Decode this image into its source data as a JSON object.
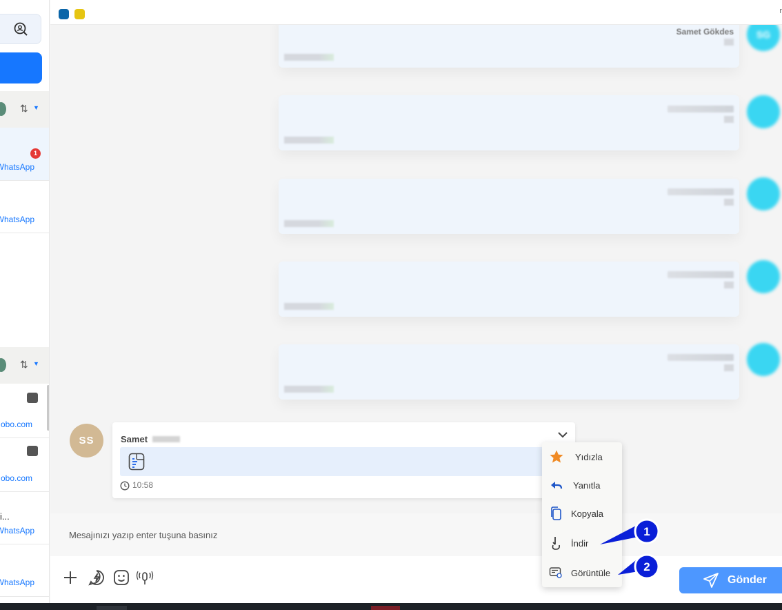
{
  "sidebar": {
    "badge_count": "1",
    "items": [
      {
        "label": "WhatsApp"
      },
      {
        "label": "WhatsApp"
      },
      {
        "label": "obo.com"
      },
      {
        "label": "obo.com"
      },
      {
        "label_top": "i...",
        "label": "WhatsApp"
      },
      {
        "label": "WhatsApp"
      }
    ]
  },
  "topbar": {
    "dot_colors": [
      "#0a65a8",
      "#e6c512"
    ],
    "corner_glyph": "r"
  },
  "messages": {
    "first_sender": "Samet Gökdes",
    "avatar_initials": "SG"
  },
  "incoming": {
    "avatar_initials": "SS",
    "sender": "Samet",
    "time": "10:58"
  },
  "context_menu": {
    "items": [
      {
        "label": "Yıdızla",
        "icon": "star-icon"
      },
      {
        "label": "Yanıtla",
        "icon": "reply-icon"
      },
      {
        "label": "Kopyala",
        "icon": "copy-icon"
      },
      {
        "label": "İndir",
        "icon": "download-icon"
      },
      {
        "label": "Görüntüle",
        "icon": "view-icon"
      }
    ]
  },
  "callouts": [
    "1",
    "2"
  ],
  "composer": {
    "placeholder": "Mesajınızı yazıp enter tuşuna basınız",
    "send_label": "Gönder"
  },
  "colors": {
    "accent": "#1677ff",
    "send_button": "#4d97ff",
    "star": "#f08a24",
    "callout": "#0a1fd8"
  }
}
